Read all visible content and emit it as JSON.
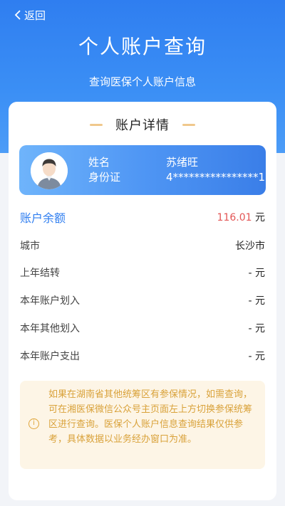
{
  "nav": {
    "back_label": "返回"
  },
  "header": {
    "title": "个人账户查询",
    "subtitle": "查询医保个人账户信息"
  },
  "card": {
    "section_title": "账户详情",
    "user": {
      "name_label": "姓名",
      "id_label": "身份证",
      "name_value": "苏绪旺",
      "id_value": "4****************1"
    },
    "balance": {
      "label": "账户余额",
      "amount": "116.01",
      "unit": "元"
    },
    "rows": [
      {
        "label": "城市",
        "value": "长沙市"
      },
      {
        "label": "上年结转",
        "value": "- 元"
      },
      {
        "label": "本年账户划入",
        "value": "- 元"
      },
      {
        "label": "本年其他划入",
        "value": "- 元"
      },
      {
        "label": "本年账户支出",
        "value": "- 元"
      }
    ],
    "notice": "如果在湖南省其他统筹区有参保情况，如需查询，可在湘医保微信公众号主页面左上方切换参保统筹区进行查询。医保个人账户信息查询结果仅供参考，具体数据以业务经办窗口为准。"
  },
  "colors": {
    "primary": "#2f7ef0",
    "amount": "#e35555",
    "notice_text": "#d9a23a",
    "notice_bg": "#fdf5e6"
  }
}
